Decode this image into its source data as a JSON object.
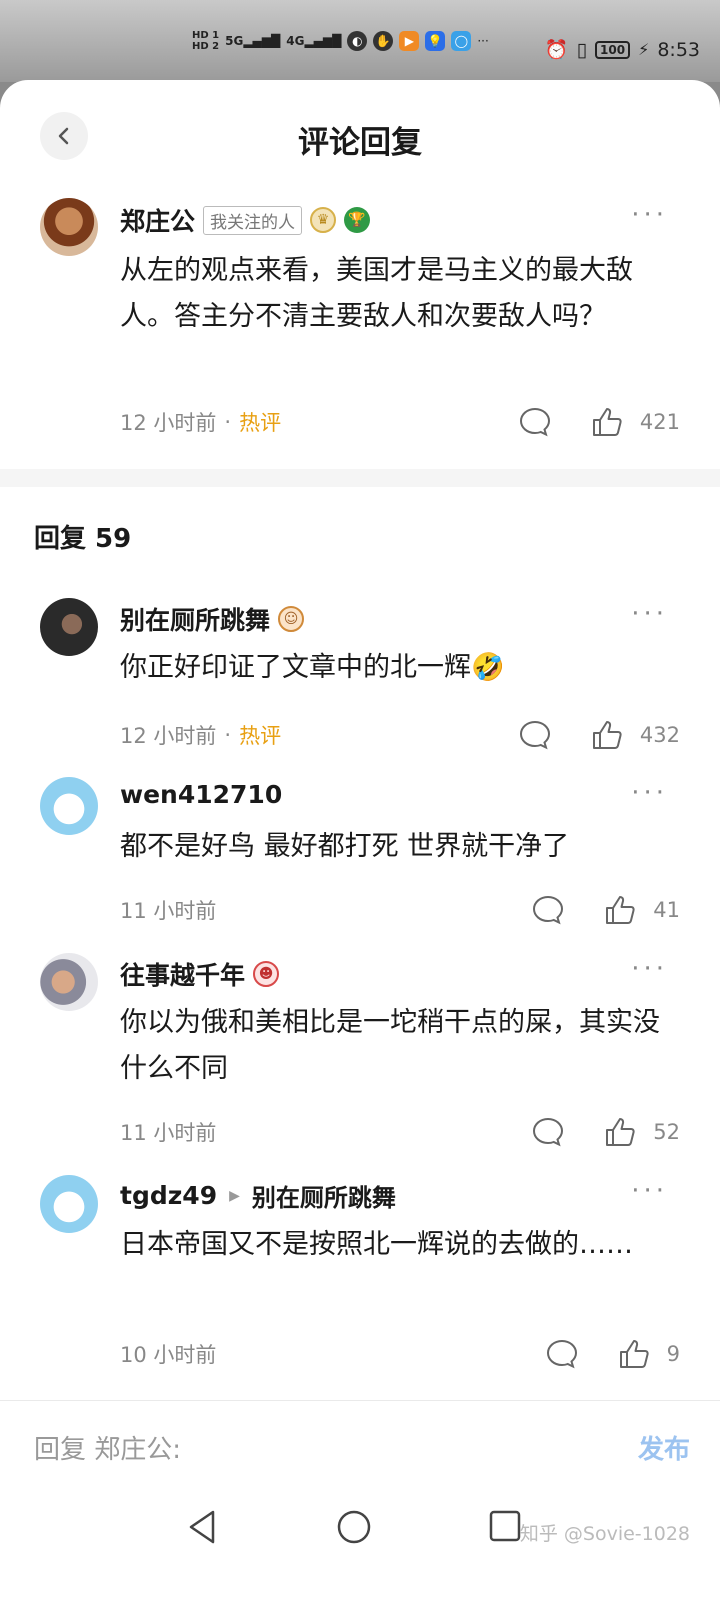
{
  "status_bar": {
    "hd1": "HD 1",
    "hd2": "HD 2",
    "sig1": "5G",
    "sig2": "4G",
    "battery": "100",
    "time": "8:53"
  },
  "header": {
    "title": "评论回复"
  },
  "main_comment": {
    "user": "郑庄公",
    "tag": "我关注的人",
    "content": "从左的观点来看，美国才是马主义的最大敌人。答主分不清主要敌人和次要敌人吗？",
    "time": "12 小时前",
    "hot": "热评",
    "likes": "421"
  },
  "replies_header": "回复 59",
  "replies": [
    {
      "user": "别在厕所跳舞",
      "content": "你正好印证了文章中的北一辉🤣",
      "time": "12 小时前",
      "hot": "热评",
      "likes": "432"
    },
    {
      "user": "wen412710",
      "content": "都不是好鸟 最好都打死 世界就干净了",
      "time": "11 小时前",
      "likes": "41"
    },
    {
      "user": "往事越千年",
      "content": "你以为俄和美相比是一坨稍干点的屎，其实没什么不同",
      "time": "11 小时前",
      "likes": "52"
    },
    {
      "user": "tgdz49",
      "reply_to": "别在厕所跳舞",
      "content": "日本帝国又不是按照北一辉说的去做的……",
      "time": "10 小时前",
      "likes": "9"
    }
  ],
  "bottom": {
    "input_placeholder": "回复 郑庄公:",
    "publish": "发布",
    "watermark": "知乎 @Sovie-1028"
  },
  "colors": {
    "hot": "#e8a013",
    "publish": "#9cc3f0"
  }
}
